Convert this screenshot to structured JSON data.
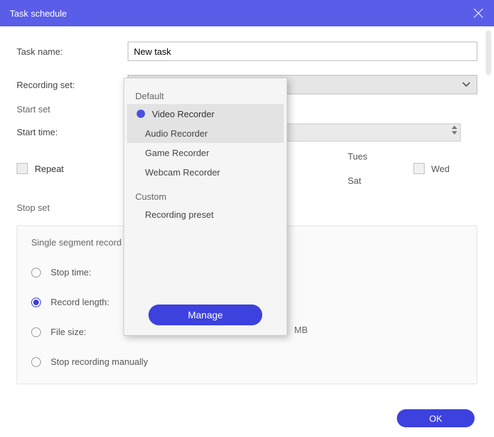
{
  "titlebar": {
    "title": "Task schedule"
  },
  "form": {
    "task_name_label": "Task name:",
    "task_name_value": "New task",
    "recording_set_label": "Recording set:",
    "recording_set_value": "Video Recorder",
    "start_set_label": "Start set",
    "start_time_label": "Start time:",
    "repeat_label": "Repeat",
    "stop_set_label": "Stop set",
    "days": {
      "tues": "Tues",
      "wed": "Wed",
      "sat": "Sat"
    }
  },
  "segment": {
    "title": "Single segment record",
    "options": {
      "stop_time": "Stop time:",
      "record_length": "Record length:",
      "file_size": "File size:",
      "manual": "Stop recording manually"
    },
    "selected": "record_length",
    "unit_mb": "MB"
  },
  "dropdown": {
    "group_default": "Default",
    "group_custom": "Custom",
    "items": {
      "video": "Video Recorder",
      "audio": "Audio Recorder",
      "game": "Game Recorder",
      "webcam": "Webcam Recorder",
      "preset": "Recording preset"
    },
    "manage_label": "Manage"
  },
  "footer": {
    "ok": "OK"
  }
}
